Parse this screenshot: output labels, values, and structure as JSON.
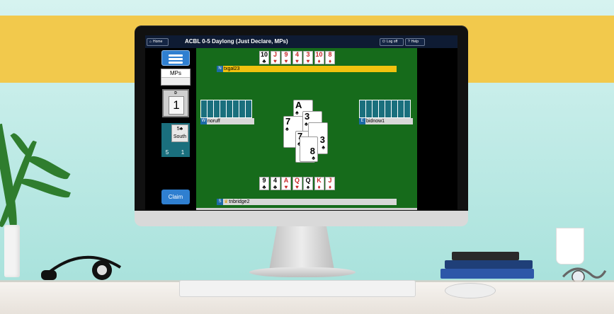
{
  "app": {
    "title": "ACBL 0-5 Daylong (Just Declare, MPs)",
    "home_label": "Home",
    "logoff_label": "Log off",
    "help_label": "Help"
  },
  "left_panel": {
    "scoring_label": "MPs",
    "dealer_label": "D",
    "board_number": "1",
    "contract": "5♣",
    "declarer": "South",
    "tricks_ns": "5",
    "tricks_ew": "1",
    "claim_label": "Claim"
  },
  "players": {
    "north": {
      "dir": "N",
      "name": "txgal23"
    },
    "west": {
      "dir": "W",
      "name": "noruff"
    },
    "east": {
      "dir": "E",
      "name": "bidnow1"
    },
    "south": {
      "dir": "S",
      "name": "tnbridge2"
    }
  },
  "north_hand": [
    {
      "rank": "10",
      "suit": "♣",
      "color": "black"
    },
    {
      "rank": "J",
      "suit": "♥",
      "color": "red"
    },
    {
      "rank": "9",
      "suit": "♥",
      "color": "red"
    },
    {
      "rank": "4",
      "suit": "♥",
      "color": "red"
    },
    {
      "rank": "3",
      "suit": "♥",
      "color": "red"
    },
    {
      "rank": "10",
      "suit": "♦",
      "color": "red"
    },
    {
      "rank": "8",
      "suit": "♦",
      "color": "red"
    }
  ],
  "south_hand": [
    {
      "rank": "9",
      "suit": "♣",
      "color": "black"
    },
    {
      "rank": "4",
      "suit": "♣",
      "color": "black"
    },
    {
      "rank": "A",
      "suit": "♥",
      "color": "red"
    },
    {
      "rank": "Q",
      "suit": "♥",
      "color": "red"
    },
    {
      "rank": "Q",
      "suit": "♠",
      "color": "black"
    },
    {
      "rank": "K",
      "suit": "♦",
      "color": "red"
    },
    {
      "rank": "J",
      "suit": "♦",
      "color": "red"
    }
  ],
  "trick": {
    "north": {
      "rank": "A",
      "suit": "♠"
    },
    "west": {
      "rank": "7",
      "suit": "♠"
    },
    "east": {
      "rank": "3",
      "suit": "♠"
    },
    "south": {
      "rank": "8",
      "suit": "♠"
    },
    "inner": {
      "rank": "3",
      "suit": "♠"
    },
    "inner2": {
      "rank": "7",
      "suit": "♠"
    }
  },
  "colors": {
    "felt": "#166b1b",
    "topbar": "#0e1b33",
    "accent": "#2f7fd0",
    "north_bar": "#f2c20f",
    "stripe": "#f2c94c"
  },
  "icons": {
    "home": "home-icon",
    "logoff": "power-icon",
    "help": "question-icon",
    "menu": "hamburger-icon"
  }
}
